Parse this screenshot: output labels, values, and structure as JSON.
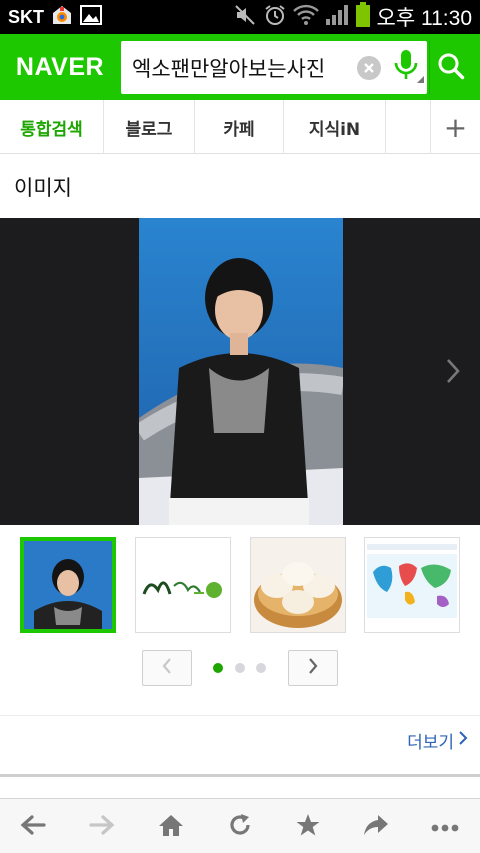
{
  "status_bar": {
    "carrier": "SKT",
    "time": "오후 11:30"
  },
  "header": {
    "logo": "NAVER",
    "search_value": "엑소팬만알아보는사진"
  },
  "tabs": [
    {
      "label": "통합검색",
      "active": true
    },
    {
      "label": "블로그",
      "active": false
    },
    {
      "label": "카페",
      "active": false
    },
    {
      "label": "지식iN",
      "active": false
    }
  ],
  "tab_add_label": "+",
  "section": {
    "title": "이미지",
    "more_label": "더보기"
  },
  "carousel": {
    "page_count": 3,
    "current_page": 1
  },
  "colors": {
    "naver_green": "#1ec800",
    "active_tab": "#1ea600",
    "link_blue": "#2d63b6"
  },
  "toolbar": {
    "icons": [
      "back-icon",
      "forward-icon",
      "home-icon",
      "refresh-icon",
      "bookmark-star-icon",
      "share-icon",
      "more-options-icon"
    ]
  }
}
